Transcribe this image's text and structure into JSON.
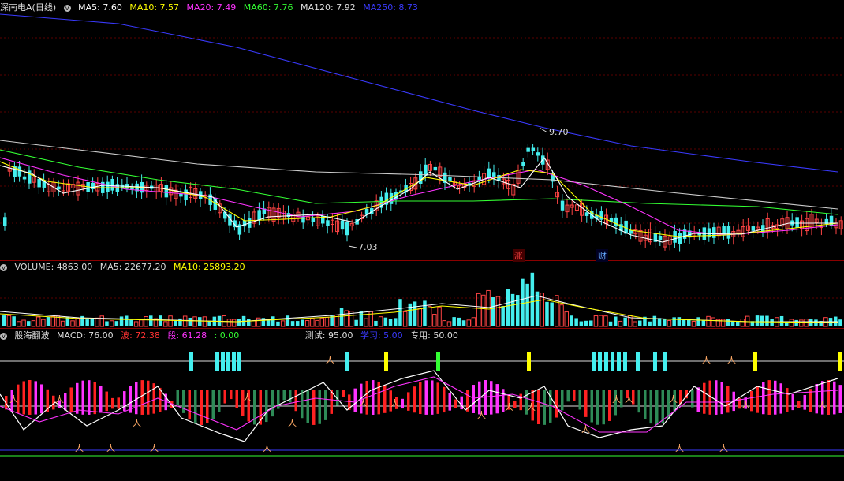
{
  "price_panel": {
    "name": "深南电A(日线)",
    "ma": [
      {
        "label": "MA5: 7.60",
        "color": "#ffffff"
      },
      {
        "label": "MA10: 7.57",
        "color": "#ffff00"
      },
      {
        "label": "MA20: 7.49",
        "color": "#ff33ff"
      },
      {
        "label": "MA60: 7.76",
        "color": "#33ff33"
      },
      {
        "label": "MA120: 7.92",
        "color": "#dddddd"
      },
      {
        "label": "MA250: 8.73",
        "color": "#3333ff"
      }
    ],
    "high_label": "9.70",
    "low_label": "7.03",
    "markers": [
      {
        "text": "涨",
        "color": "#ff4444"
      },
      {
        "text": "财",
        "color": "#66aaff"
      }
    ]
  },
  "volume_panel": {
    "items": [
      {
        "label": "VOLUME: 4863.00",
        "color": "#dddddd"
      },
      {
        "label": "MA5: 22677.20",
        "color": "#dddddd"
      },
      {
        "label": "MA10: 25893.20",
        "color": "#ffff00"
      }
    ]
  },
  "indicator_panel": {
    "items": [
      {
        "label": "股海翻波",
        "color": "#dddddd"
      },
      {
        "label": "MACD: 76.00",
        "color": "#dddddd"
      },
      {
        "label": "波: 72.38",
        "color": "#ff3333"
      },
      {
        "label": "段: 61.28",
        "color": "#ff33ff"
      },
      {
        "label": ": 0.00",
        "color": "#33ff33"
      },
      {
        "label": "测试: 95.00",
        "color": "#dddddd"
      },
      {
        "label": "学习: 5.00",
        "color": "#3333ff"
      },
      {
        "label": "专用: 50.00",
        "color": "#dddddd"
      }
    ]
  },
  "colors": {
    "up": "#ff4444",
    "down": "#44eeee",
    "ma250": "#3a3aff"
  }
}
